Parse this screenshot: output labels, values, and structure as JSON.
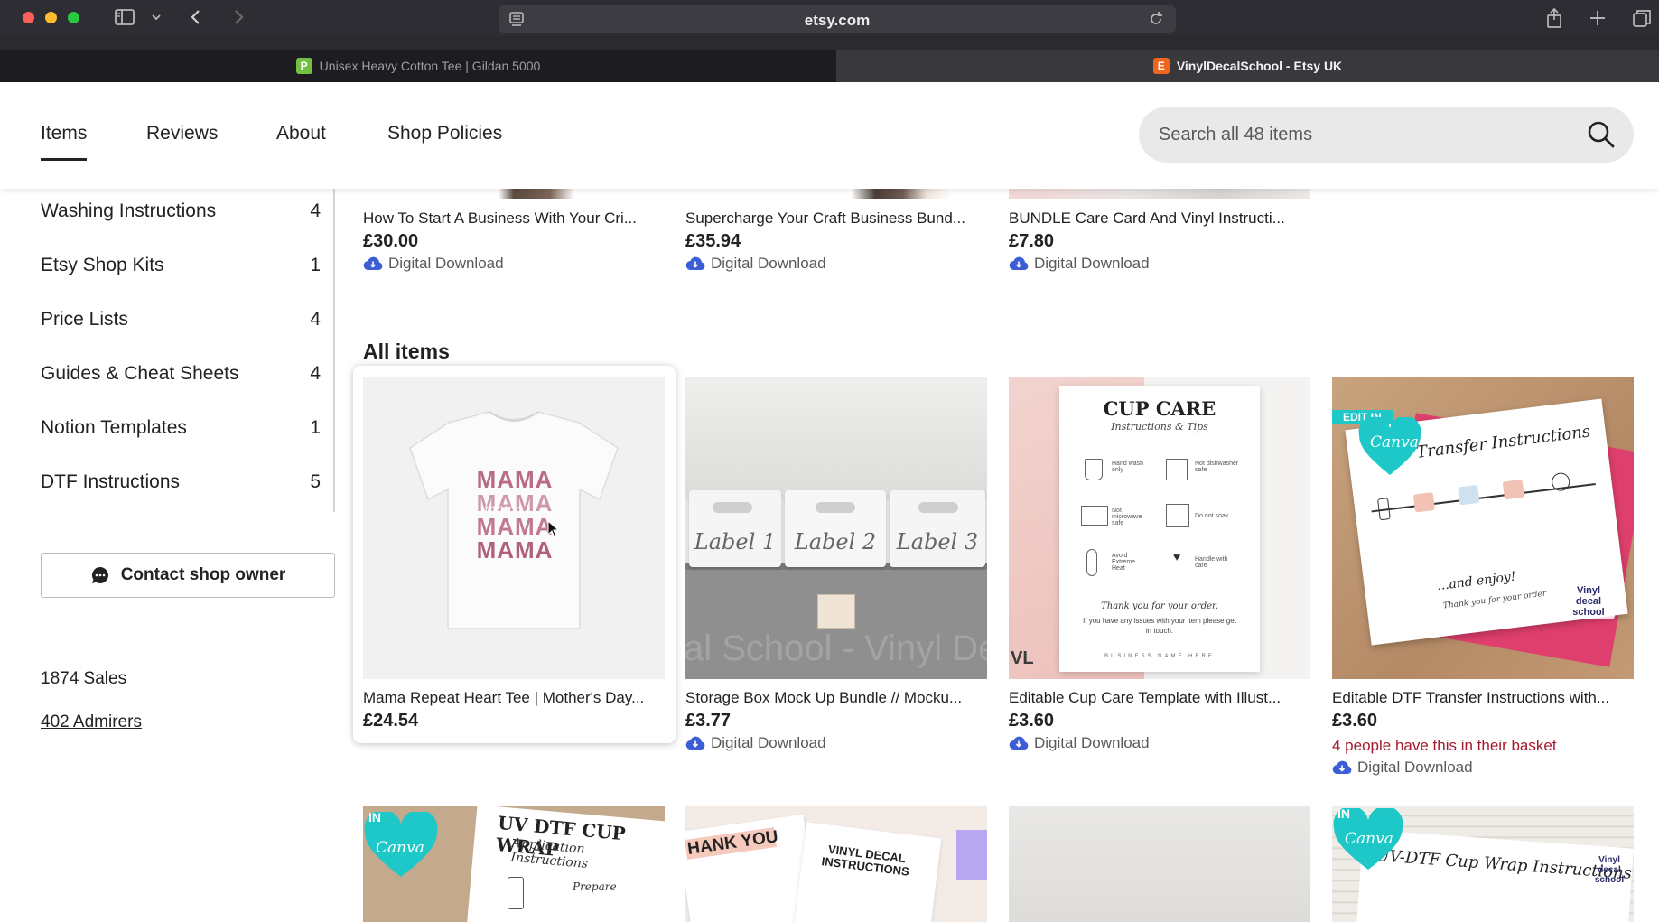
{
  "browser": {
    "url": "etsy.com",
    "tabs": [
      {
        "title": "Unisex Heavy Cotton Tee | Gildan 5000",
        "favicon": "P",
        "active": false
      },
      {
        "title": "VinylDecalSchool - Etsy UK",
        "favicon": "E",
        "active": true
      }
    ]
  },
  "shop_nav": {
    "links": [
      "Items",
      "Reviews",
      "About",
      "Shop Policies"
    ],
    "active": "Items",
    "search_placeholder": "Search all 48 items"
  },
  "sidebar": {
    "categories": [
      {
        "label": "Washing Instructions",
        "count": "4"
      },
      {
        "label": "Etsy Shop Kits",
        "count": "1"
      },
      {
        "label": "Price Lists",
        "count": "4"
      },
      {
        "label": "Guides & Cheat Sheets",
        "count": "4"
      },
      {
        "label": "Notion Templates",
        "count": "1"
      },
      {
        "label": "DTF Instructions",
        "count": "5"
      }
    ],
    "contact_label": "Contact shop owner",
    "sales": "1874 Sales",
    "admirers": "402 Admirers"
  },
  "featured_row": [
    {
      "title": "How To Start A Business With Your Cri...",
      "price": "£30.00",
      "badge": "Digital Download"
    },
    {
      "title": "Supercharge Your Craft Business Bund...",
      "price": "£35.94",
      "badge": "Digital Download"
    },
    {
      "title": "BUNDLE Care Card And Vinyl Instructi...",
      "price": "£7.80",
      "badge": "Digital Download"
    }
  ],
  "all_items": {
    "heading": "All items",
    "items": [
      {
        "title": "Mama Repeat Heart Tee | Mother's Day...",
        "price": "£24.54",
        "badge": "",
        "note": "",
        "image_text": [
          "MAMA",
          "MAMA",
          "MAMA",
          "MAMA",
          "mama"
        ]
      },
      {
        "title": "Storage Box Mock Up Bundle // Mocku...",
        "price": "£3.77",
        "badge": "Digital Download",
        "note": "",
        "image_text": [
          "Label 1",
          "Label 2",
          "Label 3",
          "al School - Vinyl Dec"
        ]
      },
      {
        "title": "Editable Cup Care Template with Illust...",
        "price": "£3.60",
        "badge": "Digital Download",
        "note": "",
        "image_text": [
          "CUP CARE",
          "Instructions & Tips",
          "Hand wash only",
          "Not dishwasher safe",
          "Not microwave safe",
          "Do not soak",
          "Avoid Extreme Heat",
          "Handle with care",
          "Thank you for your order.",
          "If you have any issues with your item please get in touch.",
          "BUSINESS NAME HERE"
        ]
      },
      {
        "title": "Editable DTF Transfer Instructions with...",
        "price": "£3.60",
        "badge": "Digital Download",
        "note": "4 people have this in their basket",
        "image_text": [
          "EDIT IN",
          "Canva",
          "DTF Transfer Instructions",
          "...and enjoy!",
          "Thank you for your order",
          "Vinyl decal school"
        ]
      }
    ],
    "next_row": [
      {
        "image_text": [
          "IN",
          "Canva",
          "UV DTF CUP WRAP",
          "Application Instructions",
          "Prepare"
        ]
      },
      {
        "image_text": [
          "HANK YOU",
          "VINYL DECAL INSTRUCTIONS"
        ]
      },
      {
        "image_text": []
      },
      {
        "image_text": [
          "IN",
          "Canva",
          "UV-DTF Cup Wrap Instructions",
          "Vinyl decal school"
        ]
      }
    ]
  },
  "colors": {
    "accent_basket": "#a61a2e",
    "chrome_bg": "#2e2d33",
    "canva_teal": "#1ec8c8"
  }
}
